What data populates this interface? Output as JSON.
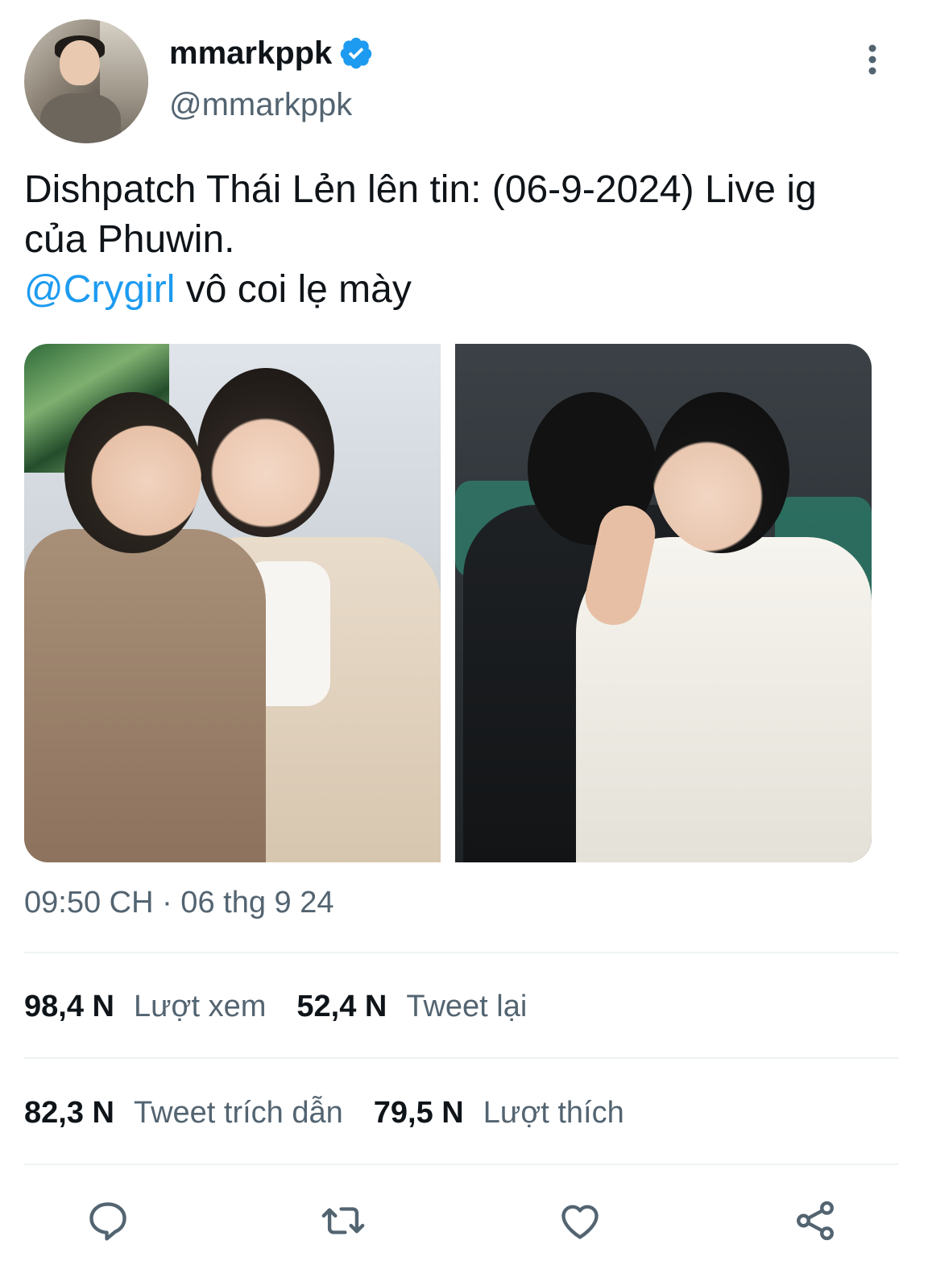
{
  "author": {
    "display_name": "mmarkppk",
    "handle": "@mmarkppk",
    "verified": true
  },
  "tweet": {
    "text_line1": "Dishpatch Thái Lẻn lên tin: (06-9-2024) Live ig",
    "text_line2": "của Phuwin.",
    "mention": "@Crygirl",
    "text_line3_rest": " vô coi lẹ mày",
    "timestamp": "09:50 CH · 06 thg 9 24"
  },
  "stats": {
    "row1": [
      {
        "value": "98,4 N",
        "label": "Lượt xem"
      },
      {
        "value": "52,4 N",
        "label": "Tweet lại"
      }
    ],
    "row2": [
      {
        "value": "82,3 N",
        "label": "Tweet trích dẫn"
      },
      {
        "value": "79,5 N",
        "label": "Lượt thích"
      }
    ]
  },
  "icons": {
    "more": "more-vertical-icon",
    "verified": "verified-badge-icon",
    "reply": "reply-icon",
    "retweet": "retweet-icon",
    "like": "heart-icon",
    "share": "share-icon"
  },
  "colors": {
    "accent": "#1d9bf0",
    "secondary_text": "#536471",
    "primary_text": "#0f1419"
  }
}
